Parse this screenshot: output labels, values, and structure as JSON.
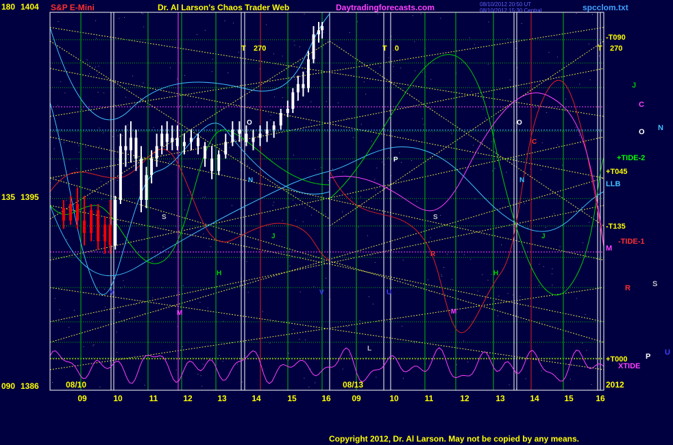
{
  "header": {
    "symbol": "S&P E-Mini",
    "title": "Dr. Al Larson's Chaos Trader Web",
    "site": "Daytradingforecasts.com",
    "date_line_1": "08/10/2012 20:50 UT",
    "date_line_2": "08/10/2012 15:30 Central",
    "file": "spcclom.txt"
  },
  "copyright": "Copyright 2012, Dr. Al Larson. May not be copied by any means.",
  "colors": {
    "background": "#000040",
    "price_bar": "#ffffff",
    "price_bar_early": "#ff0000",
    "grid_green": "#00c000",
    "pivot_yellow": "#ffff00",
    "tide_yellow": "#e0e040",
    "level_magenta": "#ff40ff",
    "level_cyan": "#40c0ff",
    "red_flow": "#e02020",
    "green_flow": "#00d000",
    "cyan_flow": "#40c0ff",
    "xtide_magenta": "#ff40ff"
  },
  "chart_data": {
    "type": "line",
    "y_axis_left": [
      {
        "angle": "180",
        "price": "1404"
      },
      {
        "angle": "135",
        "price": "1395"
      },
      {
        "angle": "090",
        "price": "1386"
      }
    ],
    "ylim": [
      1386,
      1404
    ],
    "dates": [
      "08/10",
      "08/13"
    ],
    "year": "2012",
    "x_hour_ticks": [
      "09",
      "10",
      "11",
      "12",
      "13",
      "14",
      "15",
      "16",
      "09",
      "10",
      "11",
      "12",
      "13",
      "14",
      "15",
      "16"
    ],
    "transit_markers": [
      {
        "label": "T",
        "angle": "270"
      },
      {
        "label": "T",
        "angle": "0"
      },
      {
        "label": "T",
        "angle": "270"
      }
    ],
    "right_labels": [
      {
        "text": "-T090",
        "color": "#ffff00"
      },
      {
        "text": "J",
        "color": "#00c000"
      },
      {
        "text": "C",
        "color": "#ff40ff"
      },
      {
        "text": "O",
        "color": "#ffffff"
      },
      {
        "text": "N",
        "color": "#40c0ff"
      },
      {
        "text": "+TIDE-2",
        "color": "#00ff00"
      },
      {
        "text": "+T045",
        "color": "#ffff00"
      },
      {
        "text": "LLB",
        "color": "#40c0ff"
      },
      {
        "text": "-T135",
        "color": "#ffff00"
      },
      {
        "text": "-TIDE-1",
        "color": "#ff3030"
      },
      {
        "text": "M",
        "color": "#ff40ff"
      },
      {
        "text": "R",
        "color": "#ff3030"
      },
      {
        "text": "S",
        "color": "#c0c0c0"
      },
      {
        "text": "+T000",
        "color": "#ffff00"
      },
      {
        "text": "XTIDE",
        "color": "#ff40ff"
      },
      {
        "text": "P",
        "color": "#ffffff"
      },
      {
        "text": "U",
        "color": "#4040ff"
      }
    ],
    "planet_letters": [
      {
        "text": "S",
        "color": "#c0c0c0"
      },
      {
        "text": "M",
        "color": "#ff40ff"
      },
      {
        "text": "H",
        "color": "#00d000"
      },
      {
        "text": "J",
        "color": "#00d000"
      },
      {
        "text": "N",
        "color": "#40c0ff"
      },
      {
        "text": "O",
        "color": "#ffffff"
      },
      {
        "text": "V",
        "color": "#4040ff"
      },
      {
        "text": "P",
        "color": "#ffffff"
      },
      {
        "text": "R",
        "color": "#ff3030"
      },
      {
        "text": "S",
        "color": "#c0c0c0"
      },
      {
        "text": "M",
        "color": "#ff40ff"
      },
      {
        "text": "H",
        "color": "#00d000"
      },
      {
        "text": "J",
        "color": "#00d000"
      },
      {
        "text": "O",
        "color": "#ffffff"
      },
      {
        "text": "N",
        "color": "#40c0ff"
      },
      {
        "text": "C",
        "color": "#ff3030"
      },
      {
        "text": "V",
        "color": "#4040ff"
      },
      {
        "text": "U",
        "color": "#4040ff"
      },
      {
        "text": "L",
        "color": "#c0c0c0"
      }
    ],
    "price_series": [
      {
        "t": 8.5,
        "o": 1394.6,
        "h": 1395.0,
        "l": 1393.6,
        "c": 1394.0
      },
      {
        "t": 8.7,
        "o": 1394.0,
        "h": 1395.2,
        "l": 1393.8,
        "c": 1394.8
      },
      {
        "t": 8.9,
        "o": 1394.8,
        "h": 1395.6,
        "l": 1393.6,
        "c": 1394.0
      },
      {
        "t": 9.1,
        "o": 1394.0,
        "h": 1395.2,
        "l": 1392.8,
        "c": 1393.4
      },
      {
        "t": 9.3,
        "o": 1393.4,
        "h": 1394.8,
        "l": 1393.0,
        "c": 1394.5
      },
      {
        "t": 9.5,
        "o": 1394.5,
        "h": 1394.8,
        "l": 1392.6,
        "c": 1393.0
      },
      {
        "t": 9.7,
        "o": 1393.0,
        "h": 1394.2,
        "l": 1392.4,
        "c": 1393.8
      },
      {
        "t": 9.85,
        "o": 1393.8,
        "h": 1395.0,
        "l": 1392.4,
        "c": 1392.8
      },
      {
        "t": 10.0,
        "o": 1392.8,
        "h": 1395.2,
        "l": 1392.6,
        "c": 1395.0
      },
      {
        "t": 10.15,
        "o": 1395.0,
        "h": 1398.2,
        "l": 1394.8,
        "c": 1397.6
      },
      {
        "t": 10.3,
        "o": 1397.6,
        "h": 1398.6,
        "l": 1396.6,
        "c": 1397.4
      },
      {
        "t": 10.45,
        "o": 1397.4,
        "h": 1398.8,
        "l": 1396.8,
        "c": 1398.0
      },
      {
        "t": 10.6,
        "o": 1398.0,
        "h": 1398.4,
        "l": 1396.4,
        "c": 1397.0
      },
      {
        "t": 10.75,
        "o": 1397.0,
        "h": 1397.6,
        "l": 1394.4,
        "c": 1395.0
      },
      {
        "t": 10.9,
        "o": 1395.0,
        "h": 1396.6,
        "l": 1394.6,
        "c": 1396.2
      },
      {
        "t": 11.05,
        "o": 1396.2,
        "h": 1397.4,
        "l": 1395.8,
        "c": 1397.0
      },
      {
        "t": 11.2,
        "o": 1397.0,
        "h": 1398.2,
        "l": 1396.6,
        "c": 1397.6
      },
      {
        "t": 11.35,
        "o": 1397.6,
        "h": 1398.6,
        "l": 1397.2,
        "c": 1398.2
      },
      {
        "t": 11.5,
        "o": 1398.2,
        "h": 1398.8,
        "l": 1397.4,
        "c": 1397.8
      },
      {
        "t": 11.65,
        "o": 1397.8,
        "h": 1398.6,
        "l": 1397.4,
        "c": 1398.0
      },
      {
        "t": 11.8,
        "o": 1398.0,
        "h": 1398.6,
        "l": 1397.4,
        "c": 1397.6
      },
      {
        "t": 12.0,
        "o": 1397.6,
        "h": 1398.2,
        "l": 1397.2,
        "c": 1397.8
      },
      {
        "t": 12.2,
        "o": 1397.8,
        "h": 1398.4,
        "l": 1397.4,
        "c": 1398.0
      },
      {
        "t": 12.4,
        "o": 1398.0,
        "h": 1398.2,
        "l": 1397.2,
        "c": 1397.6
      },
      {
        "t": 12.6,
        "o": 1397.6,
        "h": 1397.8,
        "l": 1396.6,
        "c": 1397.0
      },
      {
        "t": 12.8,
        "o": 1397.0,
        "h": 1397.6,
        "l": 1396.0,
        "c": 1396.4
      },
      {
        "t": 13.0,
        "o": 1396.4,
        "h": 1397.4,
        "l": 1396.2,
        "c": 1397.2
      },
      {
        "t": 13.2,
        "o": 1397.2,
        "h": 1398.2,
        "l": 1397.0,
        "c": 1397.8
      },
      {
        "t": 13.4,
        "o": 1397.8,
        "h": 1398.8,
        "l": 1397.6,
        "c": 1398.4
      },
      {
        "t": 13.6,
        "o": 1398.4,
        "h": 1398.8,
        "l": 1397.8,
        "c": 1398.2
      },
      {
        "t": 13.8,
        "o": 1398.2,
        "h": 1398.6,
        "l": 1397.6,
        "c": 1397.8
      },
      {
        "t": 14.0,
        "o": 1397.8,
        "h": 1398.4,
        "l": 1397.4,
        "c": 1398.0
      },
      {
        "t": 14.2,
        "o": 1398.0,
        "h": 1398.6,
        "l": 1397.6,
        "c": 1398.2
      },
      {
        "t": 14.4,
        "o": 1398.2,
        "h": 1398.8,
        "l": 1397.8,
        "c": 1398.4
      },
      {
        "t": 14.6,
        "o": 1398.4,
        "h": 1398.8,
        "l": 1398.0,
        "c": 1398.6
      },
      {
        "t": 14.8,
        "o": 1398.6,
        "h": 1399.4,
        "l": 1398.4,
        "c": 1399.2
      },
      {
        "t": 15.0,
        "o": 1399.2,
        "h": 1399.8,
        "l": 1399.0,
        "c": 1399.4
      },
      {
        "t": 15.15,
        "o": 1399.4,
        "h": 1400.4,
        "l": 1399.2,
        "c": 1400.2
      },
      {
        "t": 15.3,
        "o": 1400.2,
        "h": 1401.0,
        "l": 1399.8,
        "c": 1400.6
      },
      {
        "t": 15.45,
        "o": 1400.6,
        "h": 1401.2,
        "l": 1400.0,
        "c": 1400.4
      },
      {
        "t": 15.6,
        "o": 1400.4,
        "h": 1402.2,
        "l": 1400.2,
        "c": 1401.8
      },
      {
        "t": 15.75,
        "o": 1401.8,
        "h": 1403.4,
        "l": 1401.6,
        "c": 1403.0
      },
      {
        "t": 15.9,
        "o": 1403.0,
        "h": 1403.6,
        "l": 1402.6,
        "c": 1403.2
      },
      {
        "t": 16.0,
        "o": 1403.2,
        "h": 1403.6,
        "l": 1402.8,
        "c": 1403.4
      }
    ]
  }
}
